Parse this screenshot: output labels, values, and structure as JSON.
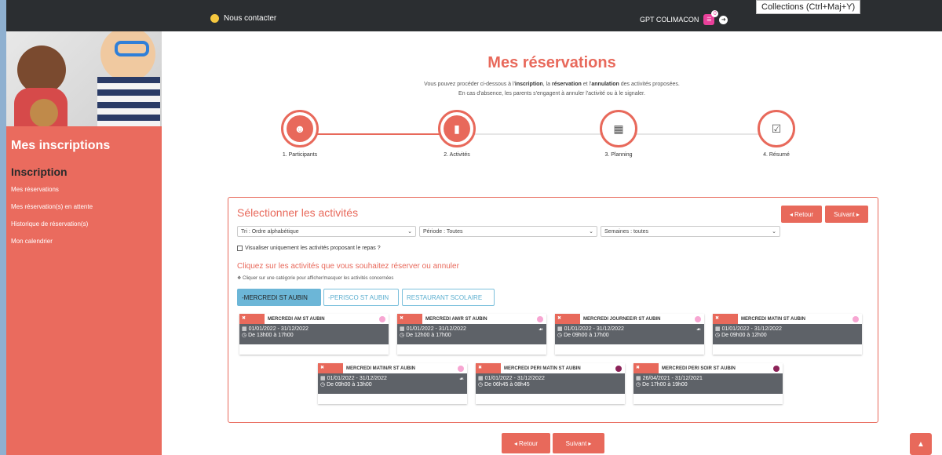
{
  "topbar": {
    "contact_label": "Nous contacter",
    "user_name": "GPT COLIMACON",
    "notif_count": "0",
    "tooltip": "Collections (Ctrl+Maj+Y)"
  },
  "sidebar": {
    "title": "Mes inscriptions",
    "subtitle": "Inscription",
    "links": [
      "Mes réservations",
      "Mes réservation(s) en attente",
      "Historique de réservation(s)",
      "Mon calendrier"
    ]
  },
  "main": {
    "page_title": "Mes réservations",
    "intro_line1_a": "Vous pouvez procéder ci-dessous à l'",
    "intro_line1_b": "inscription",
    "intro_line1_c": ", la ",
    "intro_line1_d": "réservation",
    "intro_line1_e": " et l'",
    "intro_line1_f": "annulation",
    "intro_line1_g": " des activités proposées.",
    "intro_line2": "En cas d'absence, les parents s'engagent à annuler l'activité ou à le signaler.",
    "steps": [
      {
        "label": "1. Participants",
        "icon": "users-icon",
        "active": true
      },
      {
        "label": "2. Activités",
        "icon": "book-icon",
        "active": true
      },
      {
        "label": "3. Planning",
        "icon": "calendar-icon",
        "active": false
      },
      {
        "label": "4. Résumé",
        "icon": "check-square-icon",
        "active": false
      }
    ]
  },
  "panel": {
    "title": "Sélectionner les activités",
    "back_label": "Retour",
    "next_label": "Suivant",
    "sort_select": "Tri : Ordre alphabétique",
    "period_select": "Période : Toutes",
    "weeks_select": "Semaines : toutes",
    "meal_checkbox": "Visualiser uniquement les activités proposant le repas ?",
    "click_title": "Cliquez sur les activités que vous souhaitez réserver ou annuler",
    "hint": "Cliquer sur une catégorie pour afficher/masquer les activités concernées",
    "categories": [
      "-MERCREDI ST AUBIN",
      "-PERISCO ST AUBIN",
      "RESTAURANT SCOLAIRE"
    ],
    "cards": [
      {
        "name": "MERCREDI AM ST AUBIN",
        "dates": "01/01/2022 - 31/12/2022",
        "hours": "De 13h00 à 17h00",
        "meal": false,
        "pin": "#f7a6d2"
      },
      {
        "name": "MERCREDI AM/R ST AUBIN",
        "dates": "01/01/2022 - 31/12/2022",
        "hours": "De 12h00 à 17h00",
        "meal": true,
        "pin": "#f7a6d2"
      },
      {
        "name": "MERCREDI JOURNEE/R ST AUBIN",
        "dates": "01/01/2022 - 31/12/2022",
        "hours": "De 09h00 à 17h00",
        "meal": true,
        "pin": "#f7a6d2"
      },
      {
        "name": "MERCREDI MATIN ST AUBIN",
        "dates": "01/01/2022 - 31/12/2022",
        "hours": "De 09h00 à 12h00",
        "meal": false,
        "pin": "#f7a6d2"
      },
      {
        "name": "MERCREDI MATIN/R ST AUBIN",
        "dates": "01/01/2022 - 31/12/2022",
        "hours": "De 09h00 à 13h00",
        "meal": true,
        "pin": "#f7a6d2"
      },
      {
        "name": "MERCREDI PERI MATIN ST AUBIN",
        "dates": "01/01/2022 - 31/12/2022",
        "hours": "De 06h45 à 08h45",
        "meal": false,
        "pin": "#8c2358"
      },
      {
        "name": "MERCREDI PERI SOIR ST AUBIN",
        "dates": "26/04/2021 - 31/12/2021",
        "hours": "De 17h00 à 19h00",
        "meal": false,
        "pin": "#8c2358"
      }
    ]
  },
  "footer": {
    "back_label": "Retour",
    "next_label": "Suivant"
  },
  "colors": {
    "accent": "#e8695b",
    "topbar": "#2b2e31",
    "category_active": "#6cb6d7",
    "card_body": "#5e6268"
  }
}
